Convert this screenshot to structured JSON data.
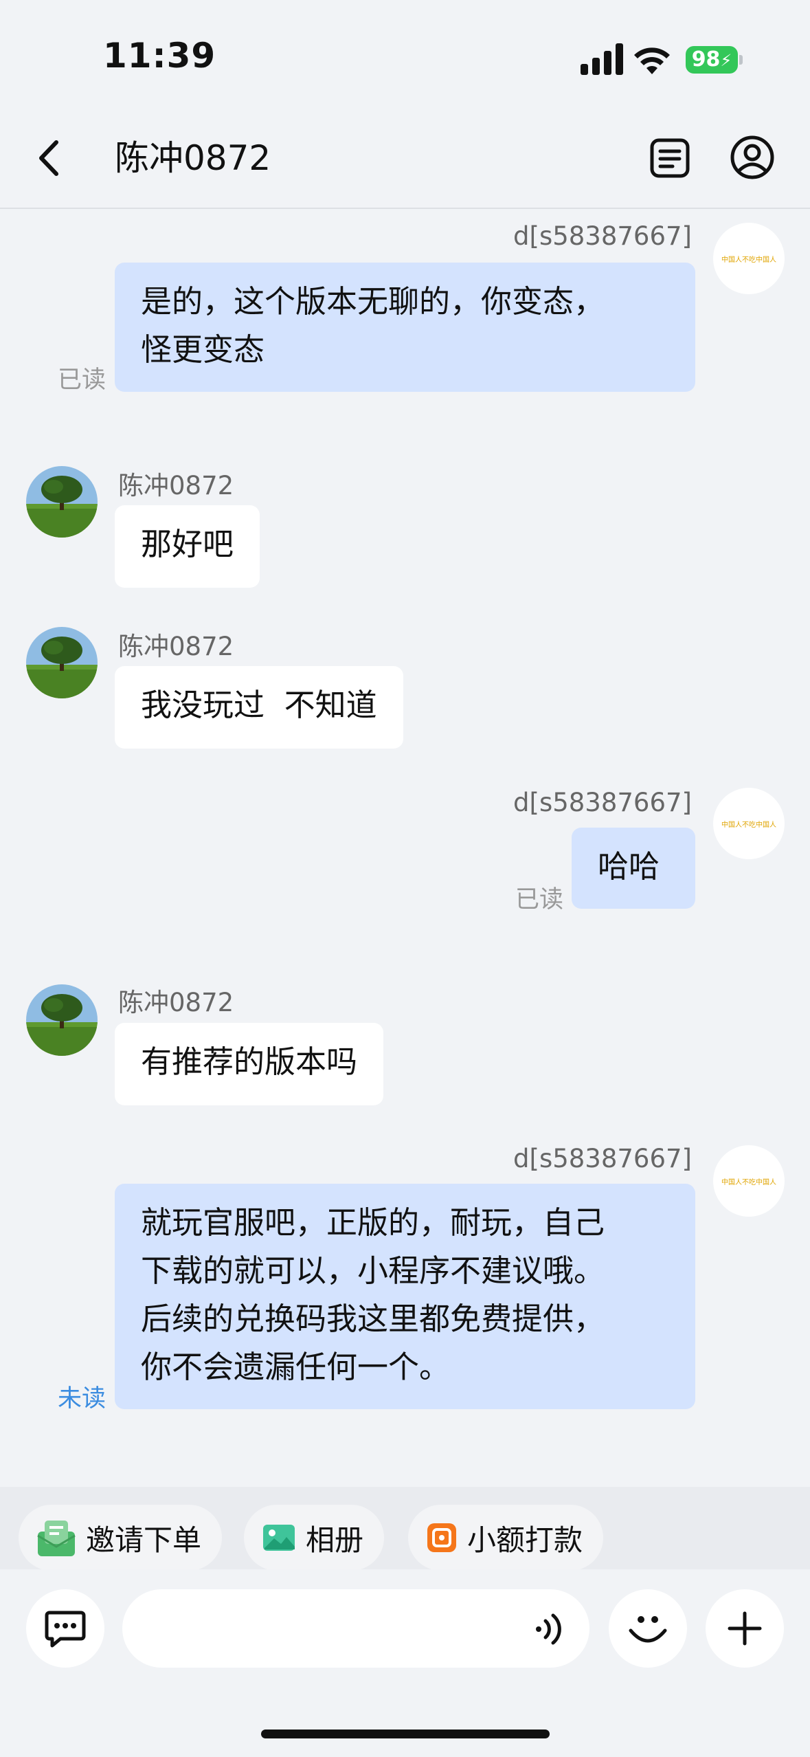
{
  "status": {
    "time": "11:39",
    "battery": "98"
  },
  "header": {
    "title": "陈冲0872"
  },
  "messages": [
    {
      "side": "right",
      "sender": "d[s58387667]",
      "text_lines": [
        "是的，这个版本无聊的，你变态，",
        "怪更变态"
      ],
      "state": "已读",
      "avatar_text": "中国人不吃中国人"
    },
    {
      "side": "left",
      "sender": "陈冲0872",
      "text": "那好吧"
    },
    {
      "side": "left",
      "sender": "陈冲0872",
      "text": "我没玩过  不知道"
    },
    {
      "side": "right",
      "sender": "d[s58387667]",
      "text": "哈哈",
      "state": "已读",
      "avatar_text": "中国人不吃中国人"
    },
    {
      "side": "left",
      "sender": "陈冲0872",
      "text": "有推荐的版本吗"
    },
    {
      "side": "right",
      "sender": "d[s58387667]",
      "text_lines": [
        "就玩官服吧，正版的，耐玩，自己",
        "下载的就可以，小程序不建议哦。",
        "后续的兑换码我这里都免费提供，",
        "你不会遗漏任何一个。"
      ],
      "state": "未读",
      "avatar_text": "中国人不吃中国人"
    }
  ],
  "quick_actions": [
    {
      "label": "邀请下单",
      "icon": "invite-order-icon",
      "color": "#4bb86a"
    },
    {
      "label": "相册",
      "icon": "album-icon",
      "color": "#3fc49a"
    },
    {
      "label": "小额打款",
      "icon": "small-payment-icon",
      "color": "#f5761a"
    }
  ],
  "colors": {
    "bubble_right": "#d4e3fe",
    "bubble_left": "#ffffff",
    "unread": "#3b8ce0",
    "battery": "#33c759"
  }
}
